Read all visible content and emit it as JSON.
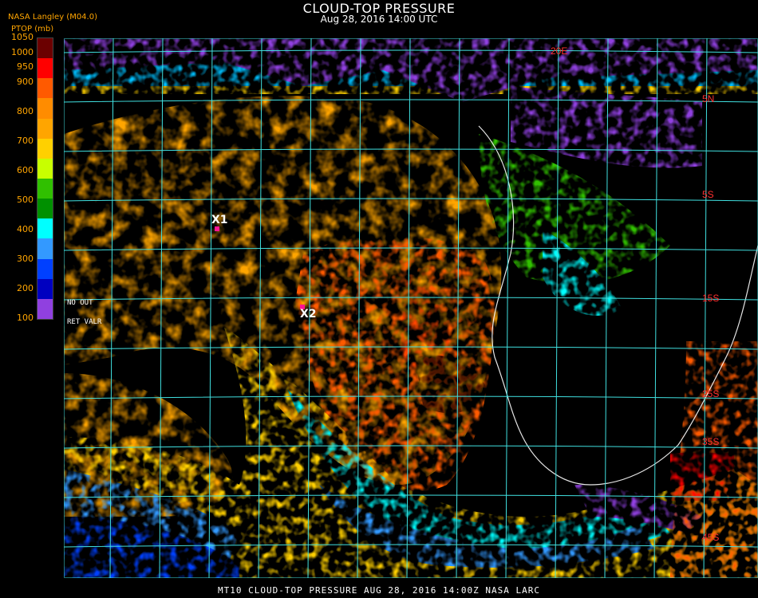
{
  "title": "CLOUD-TOP PRESSURE",
  "subtitle": "Aug 28, 2016 14:00 UTC",
  "producer": "NASA Langley  (M04.0)",
  "units": "PTOP (mb)",
  "legend": {
    "ticks": [
      "1050",
      "1000",
      "950",
      "900",
      "850",
      "800",
      "750",
      "700",
      "650",
      "600",
      "550",
      "500",
      "450",
      "400",
      "350",
      "300",
      "250",
      "200",
      "150",
      "100"
    ],
    "shown_ticks": [
      "1050",
      "1000",
      "950",
      "900",
      "800",
      "700",
      "600",
      "500",
      "400",
      "300",
      "200",
      "100"
    ],
    "colors": [
      "#6b0000",
      "#ff0000",
      "#ff5a00",
      "#ff8c00",
      "#ffa500",
      "#ffd000",
      "#c8ff00",
      "#30c000",
      "#009000",
      "#00ffff",
      "#3399ff",
      "#0040ff",
      "#0000c0",
      "#9040e0"
    ],
    "no_out": "NO   OUT",
    "ret_valr": "RET  VALR"
  },
  "markers": [
    {
      "label": "X1"
    },
    {
      "label": "X2"
    }
  ],
  "grid_labels": [
    "20E",
    "5N",
    "5S",
    "15S",
    "25S",
    "35S",
    "45S"
  ],
  "footer": "MT10   CLOUD-TOP PRESSURE   AUG 28, 2016 14:00Z   NASA LARC",
  "colors": {
    "grid": "#40e0e0",
    "coast": "#ffffff",
    "text_accent": "#ffa500"
  }
}
